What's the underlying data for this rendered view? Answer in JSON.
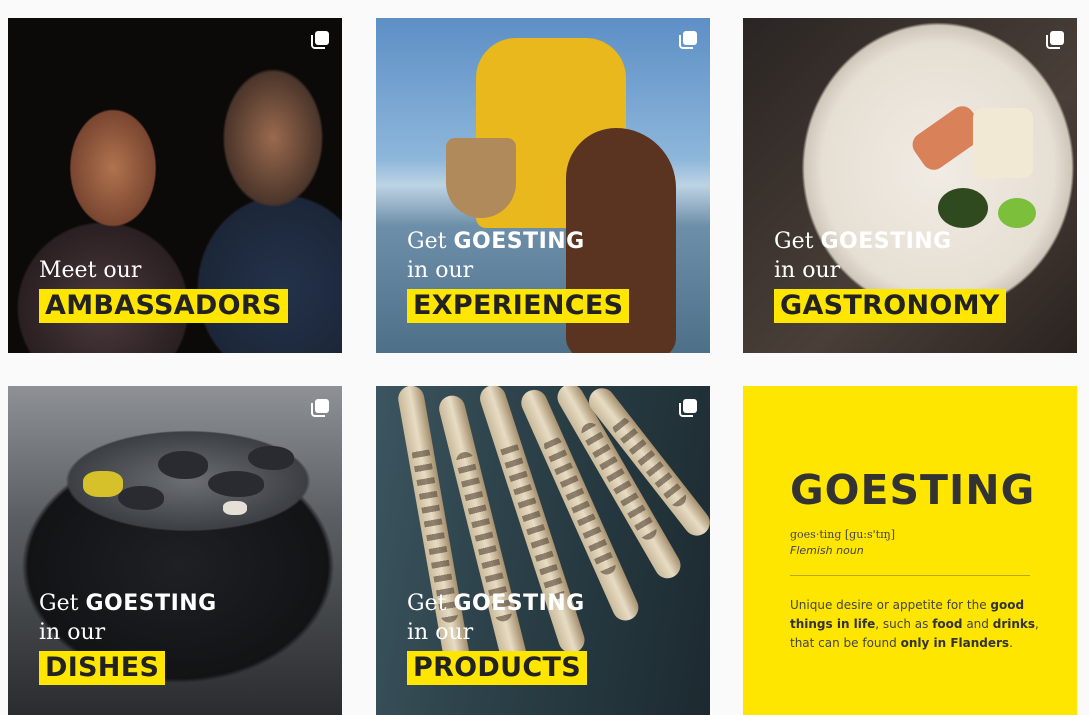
{
  "grid": {
    "tiles": [
      {
        "id": "ambassadors",
        "line1_pre": "Meet our",
        "line1_bold": "",
        "line2": "",
        "highlight": "AMBASSADORS",
        "icon": "multiple-images-icon"
      },
      {
        "id": "experiences",
        "line1_pre": "Get ",
        "line1_bold": "GOESTING",
        "line2": "in our",
        "highlight": "EXPERIENCES",
        "icon": "multiple-images-icon"
      },
      {
        "id": "gastronomy",
        "line1_pre": "Get ",
        "line1_bold": "GOESTING",
        "line2": "in our",
        "highlight": "GASTRONOMY",
        "icon": "multiple-images-icon"
      },
      {
        "id": "dishes",
        "line1_pre": "Get ",
        "line1_bold": "GOESTING",
        "line2": "in our",
        "highlight": "DISHES",
        "icon": "multiple-images-icon"
      },
      {
        "id": "products",
        "line1_pre": "Get ",
        "line1_bold": "GOESTING",
        "line2": "in our",
        "highlight": "PRODUCTS",
        "icon": "multiple-images-icon"
      }
    ],
    "definition": {
      "title": "GOESTING",
      "pronunciation": "goes·ting [ɡu:s'tɪŋ]",
      "word_type": "Flemish noun",
      "body_parts": [
        {
          "text": "Unique desire or appetite for the ",
          "bold": false
        },
        {
          "text": "good things in life",
          "bold": true
        },
        {
          "text": ", such as ",
          "bold": false
        },
        {
          "text": "food",
          "bold": true
        },
        {
          "text": " and ",
          "bold": false
        },
        {
          "text": "drinks",
          "bold": true
        },
        {
          "text": ", that can be found ",
          "bold": false
        },
        {
          "text": "only in Flanders",
          "bold": true
        },
        {
          "text": ".",
          "bold": false
        }
      ]
    }
  },
  "colors": {
    "brand_yellow": "#ffe600",
    "page_bg": "#fafafa"
  }
}
